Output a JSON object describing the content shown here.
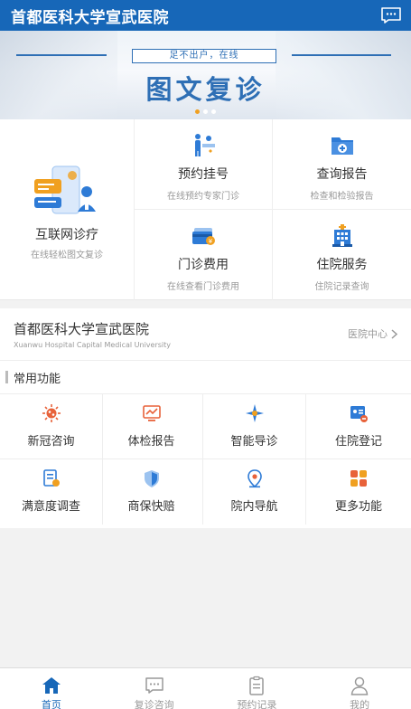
{
  "header": {
    "title": "首都医科大学宣武医院",
    "message_icon": "chat-bubble-icon"
  },
  "banner": {
    "subtitle": "足不出户，在线",
    "headline": "图文复诊",
    "slides": 3,
    "active_slide": 1
  },
  "services": {
    "internet_clinic": {
      "name": "互联网诊疗",
      "desc": "在线轻松图文复诊",
      "icon": "doctor-phone-illustration"
    },
    "items": [
      {
        "name": "预约挂号",
        "desc": "在线预约专家门诊",
        "icon": "registration-desk-icon"
      },
      {
        "name": "查询报告",
        "desc": "检查和检验报告",
        "icon": "medical-folder-icon"
      },
      {
        "name": "门诊费用",
        "desc": "在线查看门诊费用",
        "icon": "card-payment-icon"
      },
      {
        "name": "住院服务",
        "desc": "住院记录查询",
        "icon": "hospital-building-icon"
      }
    ]
  },
  "hospital": {
    "name": "首都医科大学宣武医院",
    "english": "Xuanwu Hospital Capital Medical University",
    "center_link": "医院中心"
  },
  "common": {
    "title": "常用功能",
    "items": [
      {
        "label": "新冠咨询",
        "icon": "virus-icon"
      },
      {
        "label": "体检报告",
        "icon": "monitor-chart-icon"
      },
      {
        "label": "智能导诊",
        "icon": "compass-guide-icon"
      },
      {
        "label": "住院登记",
        "icon": "id-card-icon"
      },
      {
        "label": "满意度调查",
        "icon": "survey-form-icon"
      },
      {
        "label": "商保快赔",
        "icon": "insurance-shield-icon"
      },
      {
        "label": "院内导航",
        "icon": "map-pin-icon"
      },
      {
        "label": "更多功能",
        "icon": "grid-apps-icon"
      }
    ]
  },
  "tabbar": {
    "items": [
      {
        "label": "首页",
        "icon": "home-icon",
        "active": true
      },
      {
        "label": "复诊咨询",
        "icon": "chat-icon",
        "active": false
      },
      {
        "label": "预约记录",
        "icon": "clipboard-icon",
        "active": false
      },
      {
        "label": "我的",
        "icon": "user-icon",
        "active": false
      }
    ]
  },
  "colors": {
    "primary": "#1767b8",
    "accent_orange": "#f0a020",
    "icon_blue": "#2e7bd6",
    "icon_red": "#e8623a",
    "icon_green": "#2fb36b",
    "background": "#f2f2f2"
  }
}
